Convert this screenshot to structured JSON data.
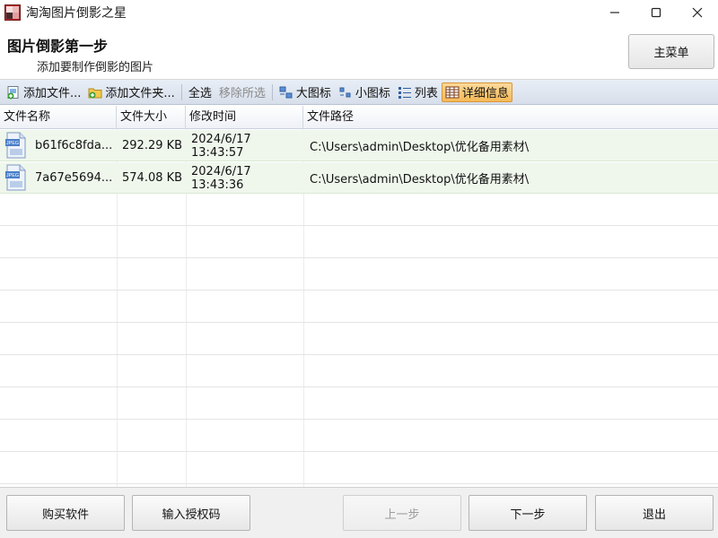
{
  "window": {
    "title": "淘淘图片倒影之星",
    "minimize_label": "—",
    "maximize_label": "☐",
    "close_label": "✕"
  },
  "header": {
    "step_title": "图片倒影第一步",
    "step_subtitle": "添加要制作倒影的图片",
    "main_menu_label": "主菜单"
  },
  "toolbar": {
    "add_files": "添加文件...",
    "add_folder": "添加文件夹...",
    "select_all": "全选",
    "remove_selected": "移除所选",
    "large_icons": "大图标",
    "small_icons": "小图标",
    "list": "列表",
    "details": "详细信息"
  },
  "table": {
    "columns": [
      "文件名称",
      "文件大小",
      "修改时间",
      "文件路径"
    ],
    "rows": [
      {
        "name": "b61f6c8fda...",
        "size": "292.29 KB",
        "date": "2024/6/17",
        "time": "13:43:57",
        "path": "C:\\Users\\admin\\Desktop\\优化备用素材\\"
      },
      {
        "name": "7a67e5694...",
        "size": "574.08 KB",
        "date": "2024/6/17",
        "time": "13:43:36",
        "path": "C:\\Users\\admin\\Desktop\\优化备用素材\\"
      }
    ],
    "file_icon_label": "JPEG"
  },
  "footer": {
    "buy": "购买软件",
    "enter_license": "输入授权码",
    "prev": "上一步",
    "next": "下一步",
    "exit": "退出"
  },
  "colors": {
    "row_highlight": "#eff7ec",
    "active_view": "#f5b957",
    "toolbar_bg": "#dce3ee"
  }
}
